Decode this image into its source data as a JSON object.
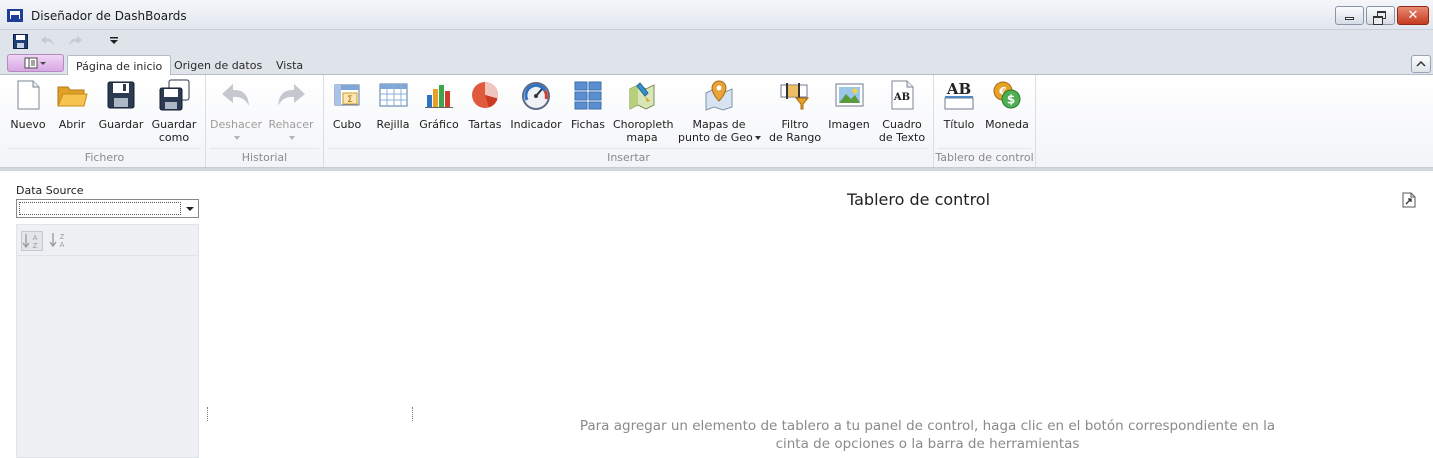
{
  "window": {
    "title": "Diseñador de DashBoards"
  },
  "quick_access": {
    "items": [
      "save-icon",
      "undo-icon",
      "redo-icon",
      "customize-dropdown-icon"
    ]
  },
  "tabs": [
    {
      "label": "Página de inicio",
      "active": true
    },
    {
      "label": "Origen de datos",
      "active": false
    },
    {
      "label": "Vista",
      "active": false
    }
  ],
  "ribbon": {
    "groups": {
      "fichero": {
        "caption": "Fichero",
        "buttons": {
          "nuevo": "Nuevo",
          "abrir": "Abrir",
          "guardar": "Guardar",
          "guardar_como_1": "Guardar",
          "guardar_como_2": "como"
        }
      },
      "historial": {
        "caption": "Historial",
        "buttons": {
          "deshacer": "Deshacer",
          "rehacer": "Rehacer"
        }
      },
      "insertar": {
        "caption": "Insertar",
        "buttons": {
          "cubo": "Cubo",
          "rejilla": "Rejilla",
          "grafico": "Gráfico",
          "tartas": "Tartas",
          "indicador": "Indicador",
          "fichas": "Fichas",
          "choropleth_1": "Choropleth",
          "choropleth_2": "mapa",
          "mapas_1": "Mapas de",
          "mapas_2": "punto de Geo",
          "filtro_1": "Filtro",
          "filtro_2": "de Rango",
          "imagen": "Imagen",
          "cuadro_1": "Cuadro",
          "cuadro_2": "de Texto"
        }
      },
      "tablero": {
        "caption": "Tablero de control",
        "buttons": {
          "titulo": "Título",
          "moneda": "Moneda"
        }
      }
    }
  },
  "data_source": {
    "label": "Data Source",
    "value": ""
  },
  "dashboard": {
    "title": "Tablero de control",
    "hint_line1": "Para agregar un elemento de tablero a tu panel de control, haga clic en el botón correspondiente en la",
    "hint_line2": "cinta de opciones o la barra de herramientas"
  },
  "colors": {
    "accent_blue": "#1d3f9a",
    "chrome": "#dfe3ea",
    "hint_gray": "#8a8a8a"
  }
}
